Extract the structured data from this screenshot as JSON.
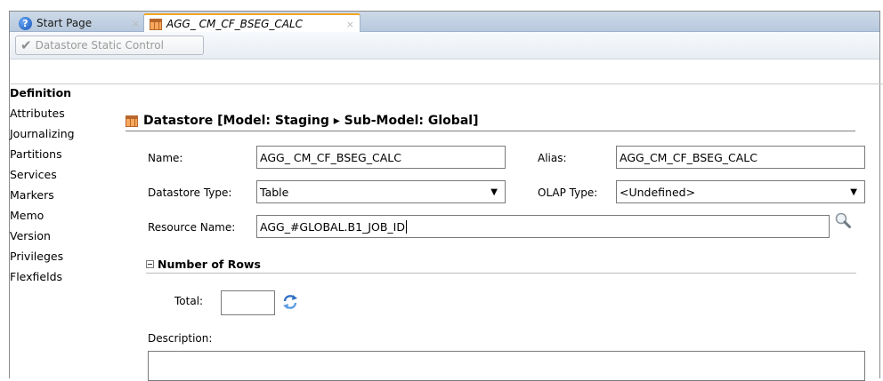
{
  "tabs": {
    "start_page": "Start Page",
    "active": "AGG_ CM_CF_BSEG_CALC",
    "close": "×"
  },
  "toolbar": {
    "static_control_label": "Datastore Static Control"
  },
  "sidebar": {
    "items": [
      {
        "label": "Definition"
      },
      {
        "label": "Attributes"
      },
      {
        "label": "Journalizing"
      },
      {
        "label": "Partitions"
      },
      {
        "label": "Services"
      },
      {
        "label": "Markers"
      },
      {
        "label": "Memo"
      },
      {
        "label": "Version"
      },
      {
        "label": "Privileges"
      },
      {
        "label": "Flexfields"
      }
    ]
  },
  "header": {
    "title": "Datastore [Model: Staging ▸ Sub-Model: Global]"
  },
  "form": {
    "name_label": "Name:",
    "name_value": "AGG_ CM_CF_BSEG_CALC",
    "alias_label": "Alias:",
    "alias_value": "AGG_CM_CF_BSEG_CALC",
    "datastore_type_label": "Datastore Type:",
    "datastore_type_value": "Table",
    "olap_type_label": "OLAP Type:",
    "olap_type_value": "<Undefined>",
    "resource_name_label": "Resource Name:",
    "resource_name_value": "AGG_#GLOBAL.B1_JOB_ID",
    "rows_section_label": "Number of Rows",
    "total_label": "Total:",
    "total_value": "",
    "description_label": "Description:"
  },
  "icons": {
    "help": "help-icon",
    "datastore": "datastore-grid-icon",
    "check": "checkmark-icon",
    "search": "search-icon",
    "refresh": "refresh-icon",
    "collapse": "collapse-icon",
    "dropdown": "chevron-down-icon"
  },
  "colors": {
    "tab_accent": "#f5a623",
    "tabbar_bg": "#ccd9e8",
    "icon_orange": "#f7a85c"
  }
}
